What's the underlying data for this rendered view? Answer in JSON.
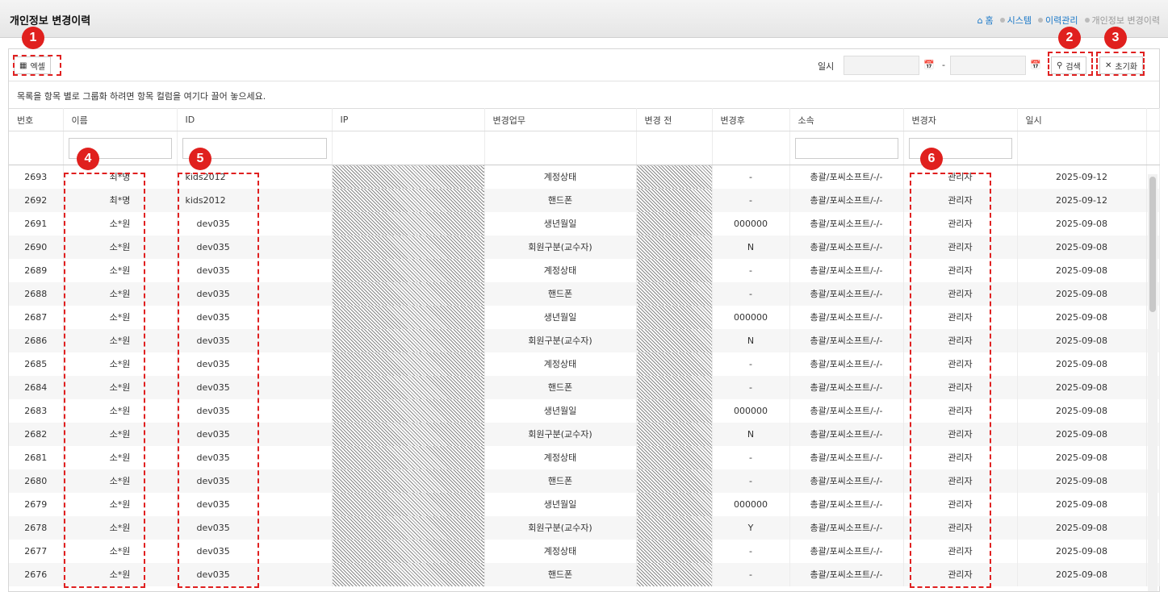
{
  "header": {
    "title": "개인정보 변경이력",
    "breadcrumb": {
      "home": "홈",
      "system": "시스템",
      "history": "이력관리",
      "current": "개인정보 변경이력"
    }
  },
  "toolbar": {
    "excel_label": "엑셀",
    "date_label": "일시",
    "date_separator": "-",
    "date_from": "",
    "date_to": "",
    "search_label": "검색",
    "reset_label": "초기화"
  },
  "grid": {
    "group_hint": "목록을 항목 별로 그룹화 하려면 항목 컬럼을 여기다 끌어 놓으세요.",
    "columns": [
      "번호",
      "이름",
      "ID",
      "IP",
      "변경업무",
      "변경 전",
      "변경후",
      "소속",
      "변경자",
      "일시"
    ],
    "rows": [
      {
        "no": "2693",
        "name": "최*명",
        "id": "kids2012",
        "task": "계정상태",
        "after": "-",
        "org": "총괄/포씨소프트/-/-",
        "changer": "관리자",
        "date": "2025-09-12"
      },
      {
        "no": "2692",
        "name": "최*명",
        "id": "kids2012",
        "task": "핸드폰",
        "after": "-",
        "org": "총괄/포씨소프트/-/-",
        "changer": "관리자",
        "date": "2025-09-12"
      },
      {
        "no": "2691",
        "name": "소*원",
        "id": "dev035",
        "task": "생년월일",
        "after": "000000",
        "org": "총괄/포씨소프트/-/-",
        "changer": "관리자",
        "date": "2025-09-08"
      },
      {
        "no": "2690",
        "name": "소*원",
        "id": "dev035",
        "task": "회원구분(교수자)",
        "after": "N",
        "org": "총괄/포씨소프트/-/-",
        "changer": "관리자",
        "date": "2025-09-08"
      },
      {
        "no": "2689",
        "name": "소*원",
        "id": "dev035",
        "task": "계정상태",
        "after": "-",
        "org": "총괄/포씨소프트/-/-",
        "changer": "관리자",
        "date": "2025-09-08"
      },
      {
        "no": "2688",
        "name": "소*원",
        "id": "dev035",
        "task": "핸드폰",
        "after": "-",
        "org": "총괄/포씨소프트/-/-",
        "changer": "관리자",
        "date": "2025-09-08"
      },
      {
        "no": "2687",
        "name": "소*원",
        "id": "dev035",
        "task": "생년월일",
        "after": "000000",
        "org": "총괄/포씨소프트/-/-",
        "changer": "관리자",
        "date": "2025-09-08"
      },
      {
        "no": "2686",
        "name": "소*원",
        "id": "dev035",
        "task": "회원구분(교수자)",
        "after": "N",
        "org": "총괄/포씨소프트/-/-",
        "changer": "관리자",
        "date": "2025-09-08"
      },
      {
        "no": "2685",
        "name": "소*원",
        "id": "dev035",
        "task": "계정상태",
        "after": "-",
        "org": "총괄/포씨소프트/-/-",
        "changer": "관리자",
        "date": "2025-09-08"
      },
      {
        "no": "2684",
        "name": "소*원",
        "id": "dev035",
        "task": "핸드폰",
        "after": "-",
        "org": "총괄/포씨소프트/-/-",
        "changer": "관리자",
        "date": "2025-09-08"
      },
      {
        "no": "2683",
        "name": "소*원",
        "id": "dev035",
        "task": "생년월일",
        "after": "000000",
        "org": "총괄/포씨소프트/-/-",
        "changer": "관리자",
        "date": "2025-09-08"
      },
      {
        "no": "2682",
        "name": "소*원",
        "id": "dev035",
        "task": "회원구분(교수자)",
        "after": "N",
        "org": "총괄/포씨소프트/-/-",
        "changer": "관리자",
        "date": "2025-09-08"
      },
      {
        "no": "2681",
        "name": "소*원",
        "id": "dev035",
        "task": "계정상태",
        "after": "-",
        "org": "총괄/포씨소프트/-/-",
        "changer": "관리자",
        "date": "2025-09-08"
      },
      {
        "no": "2680",
        "name": "소*원",
        "id": "dev035",
        "task": "핸드폰",
        "after": "-",
        "org": "총괄/포씨소프트/-/-",
        "changer": "관리자",
        "date": "2025-09-08"
      },
      {
        "no": "2679",
        "name": "소*원",
        "id": "dev035",
        "task": "생년월일",
        "after": "000000",
        "org": "총괄/포씨소프트/-/-",
        "changer": "관리자",
        "date": "2025-09-08"
      },
      {
        "no": "2678",
        "name": "소*원",
        "id": "dev035",
        "task": "회원구분(교수자)",
        "after": "Y",
        "org": "총괄/포씨소프트/-/-",
        "changer": "관리자",
        "date": "2025-09-08"
      },
      {
        "no": "2677",
        "name": "소*원",
        "id": "dev035",
        "task": "계정상태",
        "after": "-",
        "org": "총괄/포씨소프트/-/-",
        "changer": "관리자",
        "date": "2025-09-08"
      },
      {
        "no": "2676",
        "name": "소*원",
        "id": "dev035",
        "task": "핸드폰",
        "after": "-",
        "org": "총괄/포씨소프트/-/-",
        "changer": "관리자",
        "date": "2025-09-08"
      }
    ]
  },
  "annotations": [
    "1",
    "2",
    "3",
    "4",
    "5",
    "6"
  ],
  "colors": {
    "link": "#1a78c8",
    "annotation": "#e0201e"
  }
}
